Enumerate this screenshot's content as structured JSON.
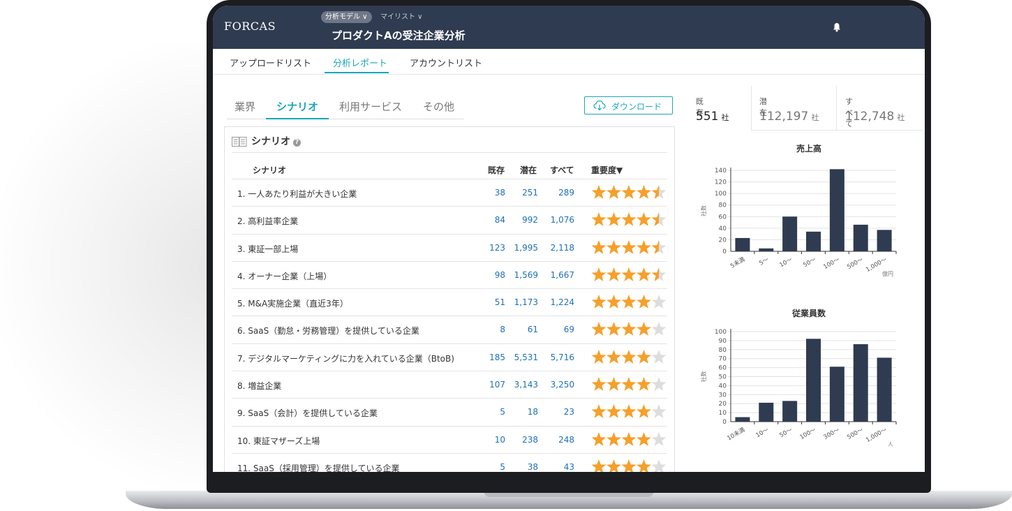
{
  "app": {
    "logo": "FORCAS"
  },
  "header": {
    "breadcrumb": [
      "分析モデル ∨",
      "マイリスト ∨"
    ],
    "title": "プロダクトAの受注企業分析"
  },
  "nav": {
    "items": [
      "アップロードリスト",
      "分析レポート",
      "アカウントリスト"
    ],
    "active": 1
  },
  "subtabs": {
    "items": [
      "業界",
      "シナリオ",
      "利用サービス",
      "その他"
    ],
    "active": 1
  },
  "download_label": "ダウンロード",
  "panel": {
    "title": "シナリオ",
    "columns": {
      "name": "シナリオ",
      "existing": "既存",
      "potential": "潜在",
      "all": "すべて",
      "importance": "重要度▼"
    },
    "rows": [
      {
        "name": "1. 一人あたり利益が大きい企業",
        "existing": "38",
        "potential": "251",
        "all": "289",
        "stars": 4.5
      },
      {
        "name": "2. 高利益率企業",
        "existing": "84",
        "potential": "992",
        "all": "1,076",
        "stars": 4.5
      },
      {
        "name": "3. 東証一部上場",
        "existing": "123",
        "potential": "1,995",
        "all": "2,118",
        "stars": 4.5
      },
      {
        "name": "4. オーナー企業（上場）",
        "existing": "98",
        "potential": "1,569",
        "all": "1,667",
        "stars": 4.5
      },
      {
        "name": "5. M&A実施企業（直近3年）",
        "existing": "51",
        "potential": "1,173",
        "all": "1,224",
        "stars": 4
      },
      {
        "name": "6. SaaS（勤怠・労務管理）を提供している企業",
        "existing": "8",
        "potential": "61",
        "all": "69",
        "stars": 4
      },
      {
        "name": "7. デジタルマーケティングに力を入れている企業（BtoB)",
        "existing": "185",
        "potential": "5,531",
        "all": "5,716",
        "stars": 4
      },
      {
        "name": "8. 増益企業",
        "existing": "107",
        "potential": "3,143",
        "all": "3,250",
        "stars": 4
      },
      {
        "name": "9. SaaS（会計）を提供している企業",
        "existing": "5",
        "potential": "18",
        "all": "23",
        "stars": 4
      },
      {
        "name": "10. 東証マザーズ上場",
        "existing": "10",
        "potential": "238",
        "all": "248",
        "stars": 4
      },
      {
        "name": "11. SaaS（採用管理）を提供している企業",
        "existing": "5",
        "potential": "38",
        "all": "43",
        "stars": 4
      }
    ]
  },
  "stats": [
    {
      "label": "既存",
      "value": "551",
      "unit": "社"
    },
    {
      "label": "潜在",
      "value": "112,197",
      "unit": "社"
    },
    {
      "label": "すべて",
      "value": "112,748",
      "unit": "社"
    }
  ],
  "colors": {
    "accent": "#1aa6b8",
    "bar": "#2f3b50",
    "star": "#f5a02b",
    "header": "#2f3b50",
    "link": "#1f6fb8"
  },
  "chart_data": [
    {
      "type": "bar",
      "title": "売上高",
      "ylabel": "社数",
      "unit": "億円",
      "categories": [
        "5未満",
        "5〜",
        "10〜",
        "50〜",
        "100〜",
        "500〜",
        "1,000〜"
      ],
      "values": [
        23,
        5,
        60,
        34,
        142,
        46,
        37
      ],
      "ylim": [
        0,
        140
      ],
      "yticks": [
        0,
        20,
        40,
        60,
        80,
        100,
        120,
        140
      ]
    },
    {
      "type": "bar",
      "title": "従業員数",
      "ylabel": "社数",
      "unit": "人",
      "categories": [
        "10未満",
        "10〜",
        "50〜",
        "100〜",
        "300〜",
        "500〜",
        "1,000〜"
      ],
      "values": [
        5,
        21,
        23,
        92,
        61,
        86,
        71
      ],
      "ylim": [
        0,
        100
      ],
      "yticks": [
        0,
        10,
        20,
        30,
        40,
        50,
        60,
        70,
        80,
        90,
        100
      ]
    }
  ]
}
